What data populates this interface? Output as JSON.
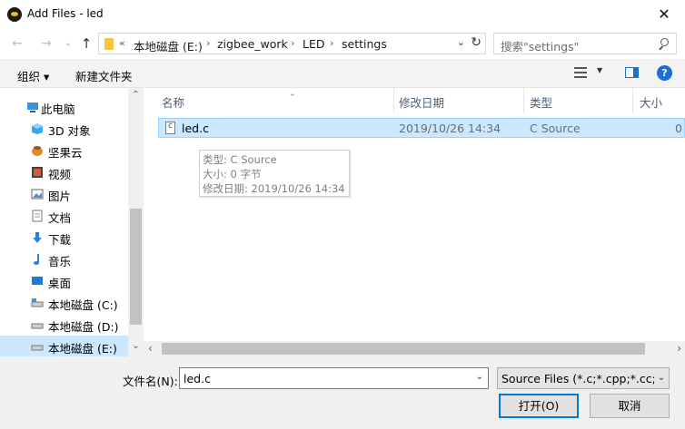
{
  "window": {
    "title": "Add Files - led",
    "close": "✕"
  },
  "nav": {
    "back": "←",
    "forward": "→",
    "recent": "⌄",
    "up": "↑",
    "address": {
      "overflow": "«",
      "segments": [
        "本地磁盘 (E:)",
        "zigbee_work",
        "LED",
        "settings"
      ],
      "separator": "›"
    },
    "search_placeholder": "搜索\"settings\""
  },
  "toolbar": {
    "organize": "组织 ▾",
    "new_folder": "新建文件夹",
    "help": "?"
  },
  "sidebar": {
    "items": [
      {
        "label": "此电脑",
        "icon": "pc-icon"
      },
      {
        "label": "3D 对象",
        "icon": "cube-icon"
      },
      {
        "label": "坚果云",
        "icon": "nut-cloud-icon"
      },
      {
        "label": "视频",
        "icon": "video-icon"
      },
      {
        "label": "图片",
        "icon": "pictures-icon"
      },
      {
        "label": "文档",
        "icon": "documents-icon"
      },
      {
        "label": "下载",
        "icon": "download-icon"
      },
      {
        "label": "音乐",
        "icon": "music-icon"
      },
      {
        "label": "桌面",
        "icon": "desktop-icon"
      },
      {
        "label": "本地磁盘 (C:)",
        "icon": "drive-icon"
      },
      {
        "label": "本地磁盘 (D:)",
        "icon": "drive-icon"
      },
      {
        "label": "本地磁盘 (E:)",
        "icon": "drive-icon",
        "selected": true
      }
    ]
  },
  "filelist": {
    "columns": [
      "名称",
      "修改日期",
      "类型",
      "大小"
    ],
    "rows": [
      {
        "name": "led.c",
        "date": "2019/10/26 14:34",
        "type": "C Source",
        "size": "0"
      }
    ],
    "tooltip": {
      "type": "类型: C Source",
      "size": "大小: 0 字节",
      "modified": "修改日期: 2019/10/26 14:34"
    }
  },
  "footer": {
    "filename_label": "文件名(N):",
    "filename_value": "led.c",
    "filter_value": "Source Files (*.c;*.cpp;*.cc;*.l",
    "open_label": "打开(O)",
    "cancel_label": "取消"
  },
  "colors": {
    "selection": "#cce8ff",
    "selection_border": "#99d1ff",
    "accent": "#0078d7"
  }
}
